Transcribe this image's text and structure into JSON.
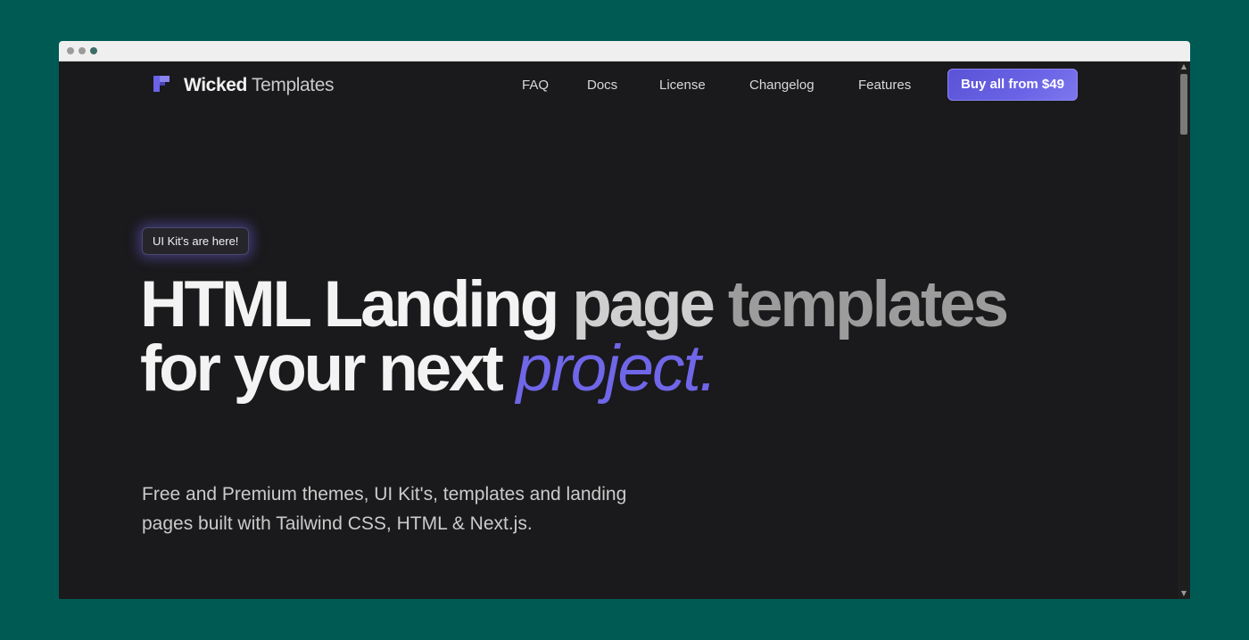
{
  "nav": {
    "logo_bold": "Wicked",
    "logo_light": "Templates",
    "links": [
      "FAQ",
      "Docs",
      "License",
      "Changelog",
      "Features"
    ],
    "cta_label": "Buy all from $49"
  },
  "hero": {
    "badge": "UI Kit's are here!",
    "title_words": [
      "HTML",
      "Landing",
      "page",
      "templates",
      "for your next",
      "project."
    ],
    "description": "Free and Premium themes, UI Kit's, templates and landing pages built with Tailwind CSS, HTML & Next.js."
  },
  "colors": {
    "page_background": "#005a54",
    "content_background": "#1a191b",
    "accent": "#6f66e8",
    "button": "#5a53d6"
  },
  "icons": {
    "logo": "logo-mark-icon",
    "scroll_up": "chevron-up-icon",
    "scroll_down": "chevron-down-icon"
  }
}
